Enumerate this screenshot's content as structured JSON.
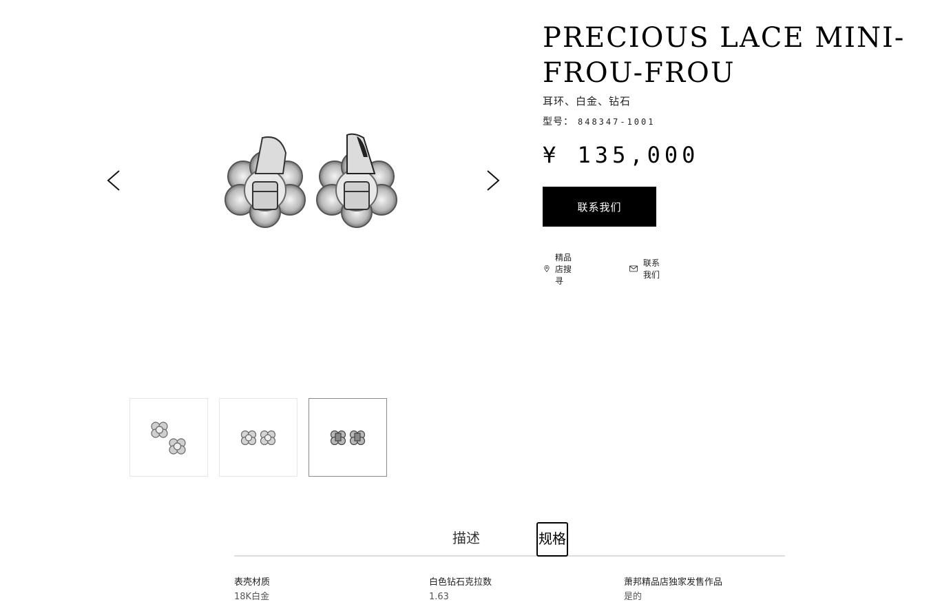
{
  "gallery": {
    "prev_icon": "chevron-left-icon",
    "next_icon": "chevron-right-icon",
    "main_image": "earrings-front-view",
    "thumbnails": [
      {
        "image": "earrings-side-view",
        "active": false
      },
      {
        "image": "earrings-pair-front-view",
        "active": false
      },
      {
        "image": "earrings-back-view",
        "active": true
      }
    ]
  },
  "product": {
    "title": "PRECIOUS LACE MINI-FROU-FROU",
    "subtitle": "耳环、白金、钻石",
    "model_label": "型号：",
    "model_value": "848347-1001",
    "price": "¥ 135,000",
    "contact_button": "联系我们",
    "store_link": {
      "label": "精品店搜寻",
      "icon": "location-pin-icon"
    },
    "contact_link": {
      "label": "联系我们",
      "icon": "envelope-icon"
    }
  },
  "tabs": [
    {
      "label": "描述",
      "active": false
    },
    {
      "label": "规格",
      "active": true
    }
  ],
  "specs": [
    {
      "label": "表壳材质",
      "value": "18K白金"
    },
    {
      "label": "白色钻石克拉数",
      "value": "1.63"
    },
    {
      "label": "萧邦精品店独家发售作品",
      "value": "是的"
    }
  ],
  "colors": {
    "button_bg": "#000000",
    "button_text": "#ffffff",
    "active_thumb_border": "#8a8a8a"
  }
}
